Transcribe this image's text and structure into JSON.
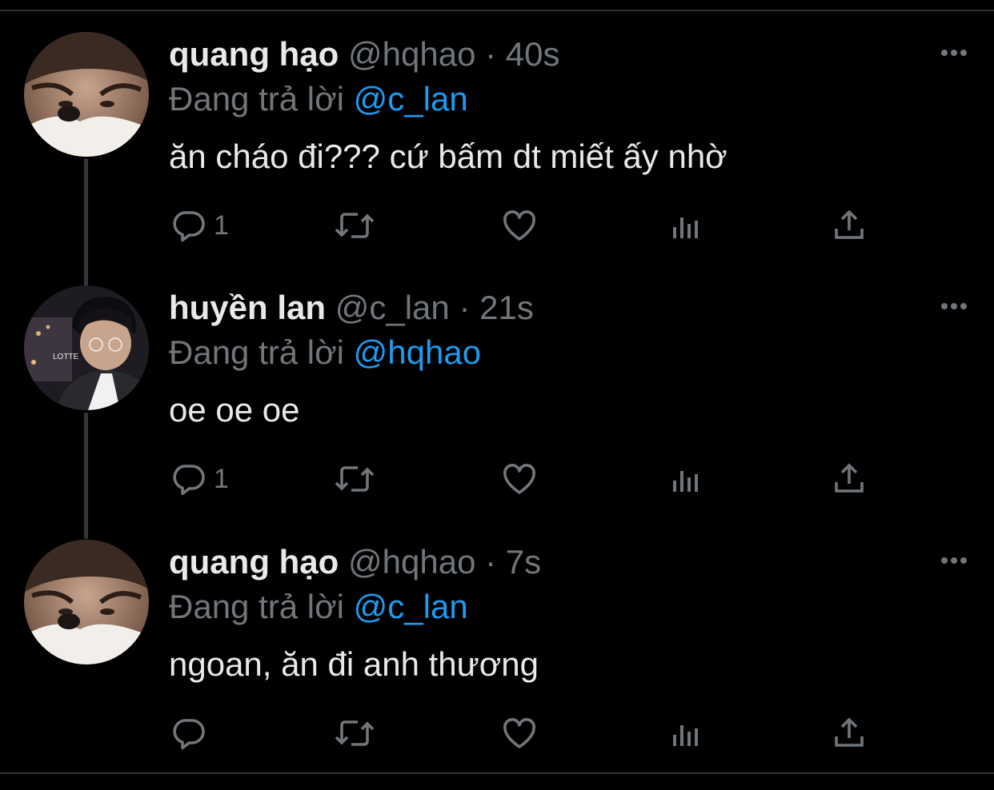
{
  "colors": {
    "background": "#000000",
    "text": "#e7e9ea",
    "muted": "#71767b",
    "mention": "#1d9bf0",
    "thread_line": "#333639"
  },
  "tweets": [
    {
      "name": "quang hạo",
      "handle": "@hqhao",
      "separator": "·",
      "time": "40s",
      "replying_label": "Đang trả lời",
      "replying_to": "@c_lan",
      "text": "ăn cháo đi??? cứ bấm dt miết ấy nhờ",
      "reply_count": "1",
      "avatar": "avatar-quang-hao"
    },
    {
      "name": "huyền lan",
      "handle": "@c_lan",
      "separator": "·",
      "time": "21s",
      "replying_label": "Đang trả lời",
      "replying_to": "@hqhao",
      "text": "oe oe oe",
      "reply_count": "1",
      "avatar": "avatar-huyen-lan"
    },
    {
      "name": "quang hạo",
      "handle": "@hqhao",
      "separator": "·",
      "time": "7s",
      "replying_label": "Đang trả lời",
      "replying_to": "@c_lan",
      "text": "ngoan, ăn đi anh thương",
      "reply_count": "",
      "avatar": "avatar-quang-hao"
    }
  ],
  "icons": {
    "reply": "reply-icon",
    "retweet": "retweet-icon",
    "like": "heart-icon",
    "views": "analytics-icon",
    "share": "share-icon",
    "more": "more-icon"
  }
}
